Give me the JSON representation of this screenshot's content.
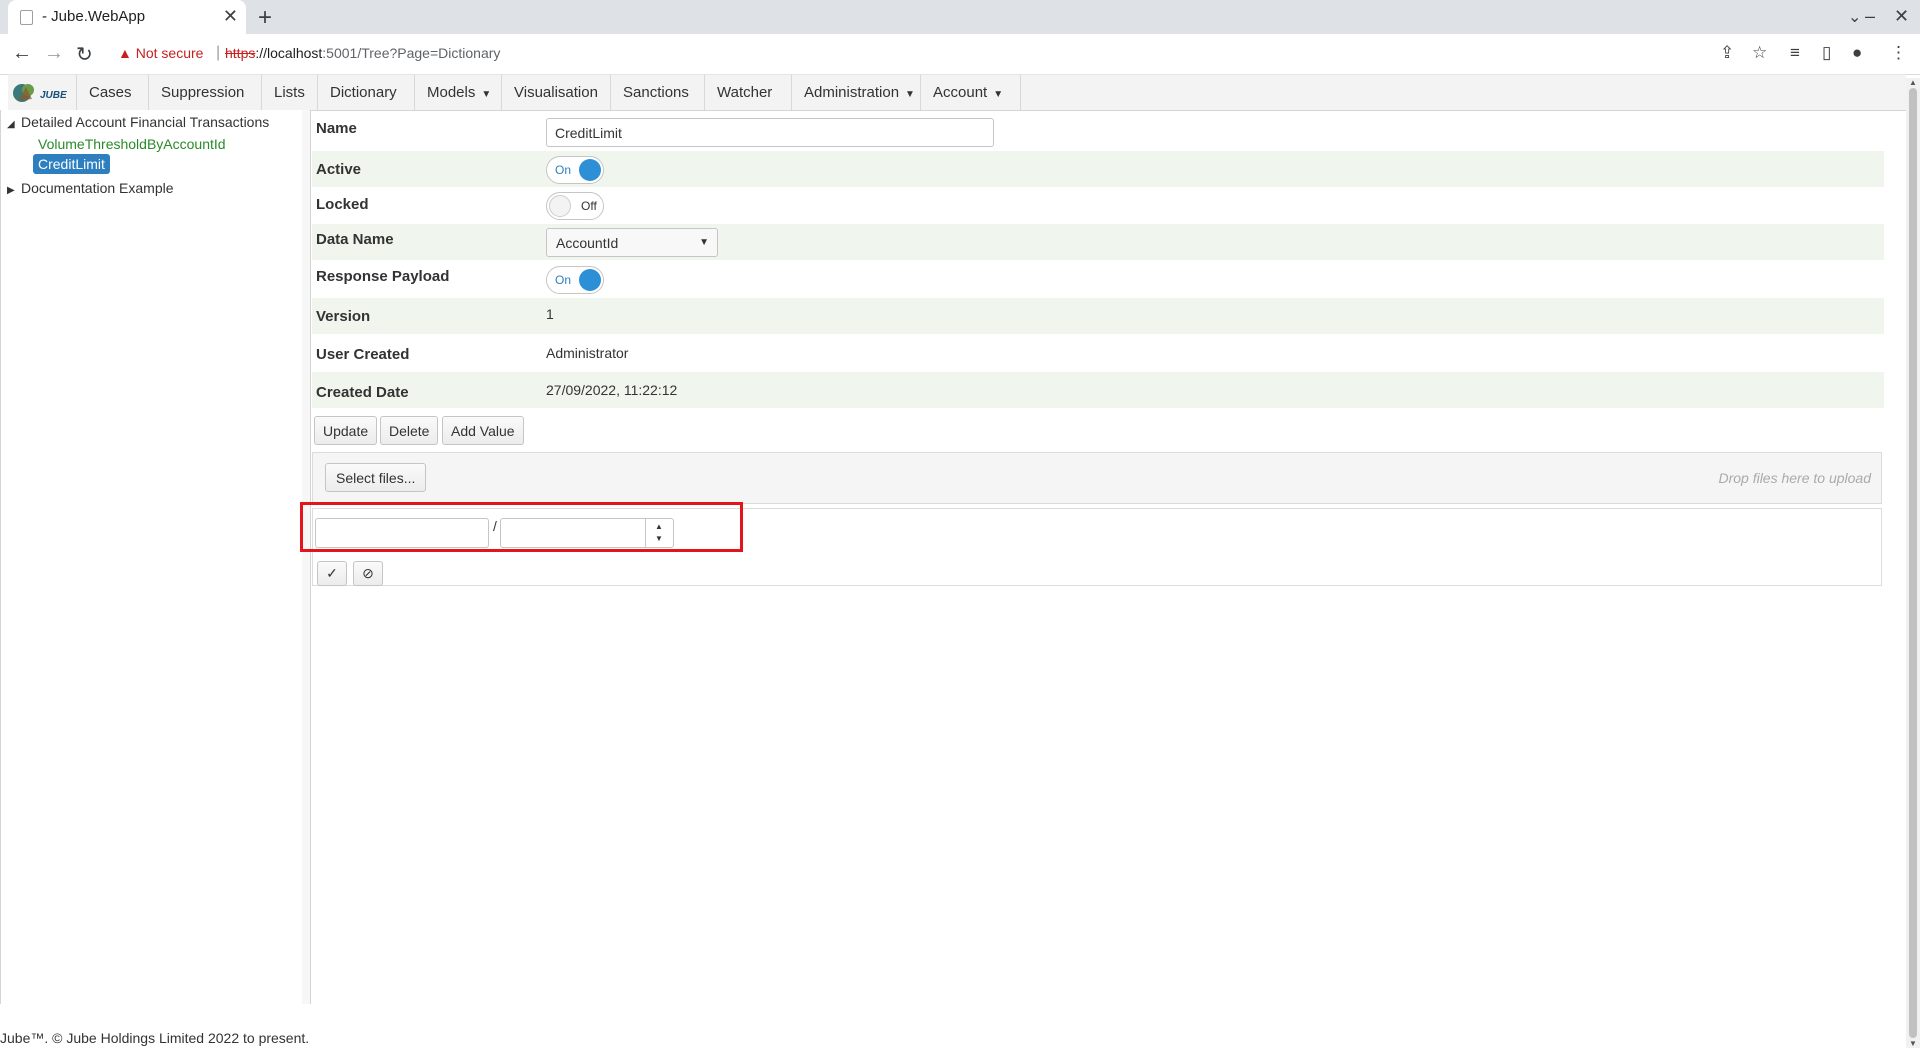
{
  "browser": {
    "tab_title": "- Jube.WebApp",
    "new_tab": "+",
    "tab_close": "✕",
    "security_label": "Not secure",
    "url_protocol": "https",
    "url_host": "://localhost",
    "url_rest": ":5001/Tree?Page=Dictionary"
  },
  "nav": {
    "items": [
      {
        "label": "Cases"
      },
      {
        "label": "Suppression"
      },
      {
        "label": "Lists"
      },
      {
        "label": "Dictionary"
      },
      {
        "label": "Models"
      },
      {
        "label": "Visualisation"
      },
      {
        "label": "Sanctions"
      },
      {
        "label": "Watcher"
      },
      {
        "label": "Administration"
      },
      {
        "label": "Account"
      }
    ]
  },
  "tree": {
    "root1": "Detailed Account Financial Transactions",
    "child1": "VolumeThresholdByAccountId",
    "child2": "CreditLimit",
    "root2": "Documentation Example"
  },
  "form": {
    "name_label": "Name",
    "name_value": "CreditLimit",
    "active_label": "Active",
    "active_state": "On",
    "locked_label": "Locked",
    "locked_state": "Off",
    "data_name_label": "Data Name",
    "data_name_value": "AccountId",
    "response_payload_label": "Response Payload",
    "response_payload_state": "On",
    "version_label": "Version",
    "version_value": "1",
    "user_created_label": "User Created",
    "user_created_value": "Administrator",
    "created_date_label": "Created Date",
    "created_date_value": "27/09/2022, 11:22:12"
  },
  "buttons": {
    "update": "Update",
    "delete": "Delete",
    "add_value": "Add Value",
    "select_files": "Select files..."
  },
  "upload": {
    "drop_hint": "Drop files here to upload"
  },
  "editor": {
    "separator": "/",
    "confirm_icon": "✓",
    "cancel_icon": "⃠"
  },
  "footer": {
    "text": "Jube™. © Jube Holdings Limited 2022 to present."
  },
  "colors": {
    "selected": "#2d7fc0",
    "highlight": "#e3141c",
    "alt_row": "#f0f6ee",
    "link": "#2a8a2a"
  }
}
